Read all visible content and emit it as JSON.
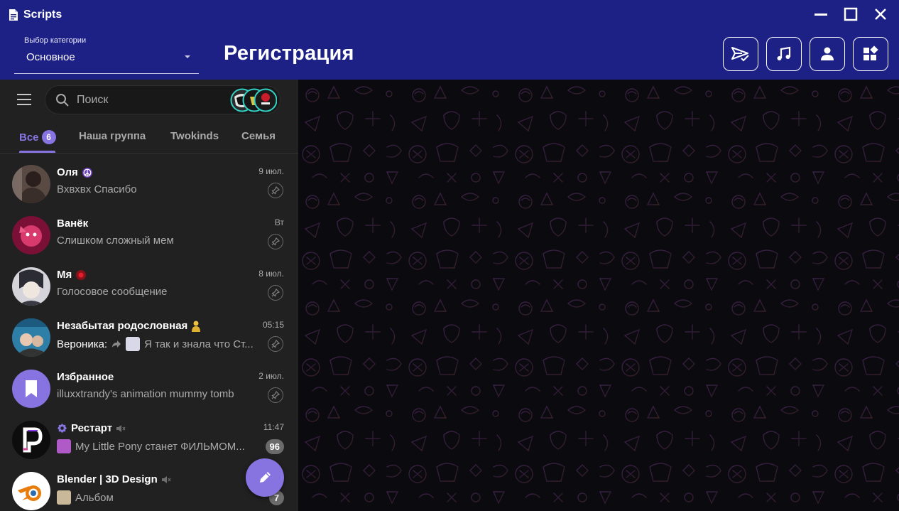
{
  "window": {
    "title": "Scripts"
  },
  "category": {
    "label": "Выбор категории",
    "value": "Основное"
  },
  "page_title": "Регистрация",
  "search": {
    "placeholder": "Поиск"
  },
  "tabs": [
    {
      "label": "Все",
      "badge": "6",
      "active": true
    },
    {
      "label": "Наша группа"
    },
    {
      "label": "Twokinds"
    },
    {
      "label": "Семья"
    }
  ],
  "chats": [
    {
      "name": "Оля",
      "time": "9 июл.",
      "message": "Вхвхвх Спасибо",
      "pinned": true,
      "avatar_color": "#5a4a44"
    },
    {
      "name": "Ванёк",
      "time": "Вт",
      "message": "Слишком сложный мем",
      "pinned": true,
      "avatar_color": "#b02a5a"
    },
    {
      "name": "Мя",
      "time": "8 июл.",
      "message": "Голосовое сообщение",
      "pinned": true,
      "avatar_color": "#c9c9cf"
    },
    {
      "name": "Незабытая родословная",
      "time": "05:15",
      "sender": "Вероника:",
      "message": "Я так и знала что Ст...",
      "pinned": true,
      "avatar_color": "#3b8fb0"
    },
    {
      "name": "Избранное",
      "time": "2 июл.",
      "message": "illuxxtrandy's animation mummy tomb",
      "pinned": true,
      "avatar_color": "#8774e1"
    },
    {
      "name": "Рестарт",
      "time": "11:47",
      "message": "My Little Pony станет ФИЛЬМОМ...",
      "count": "96",
      "avatar_color": "#101010"
    },
    {
      "name": "Blender | 3D Design",
      "time": "",
      "message": "Альбом",
      "count": "7",
      "avatar_color": "#ffffff"
    }
  ],
  "colors": {
    "titlebar": "#1d2185",
    "accent": "#8774e1",
    "sidebar": "#212121"
  }
}
